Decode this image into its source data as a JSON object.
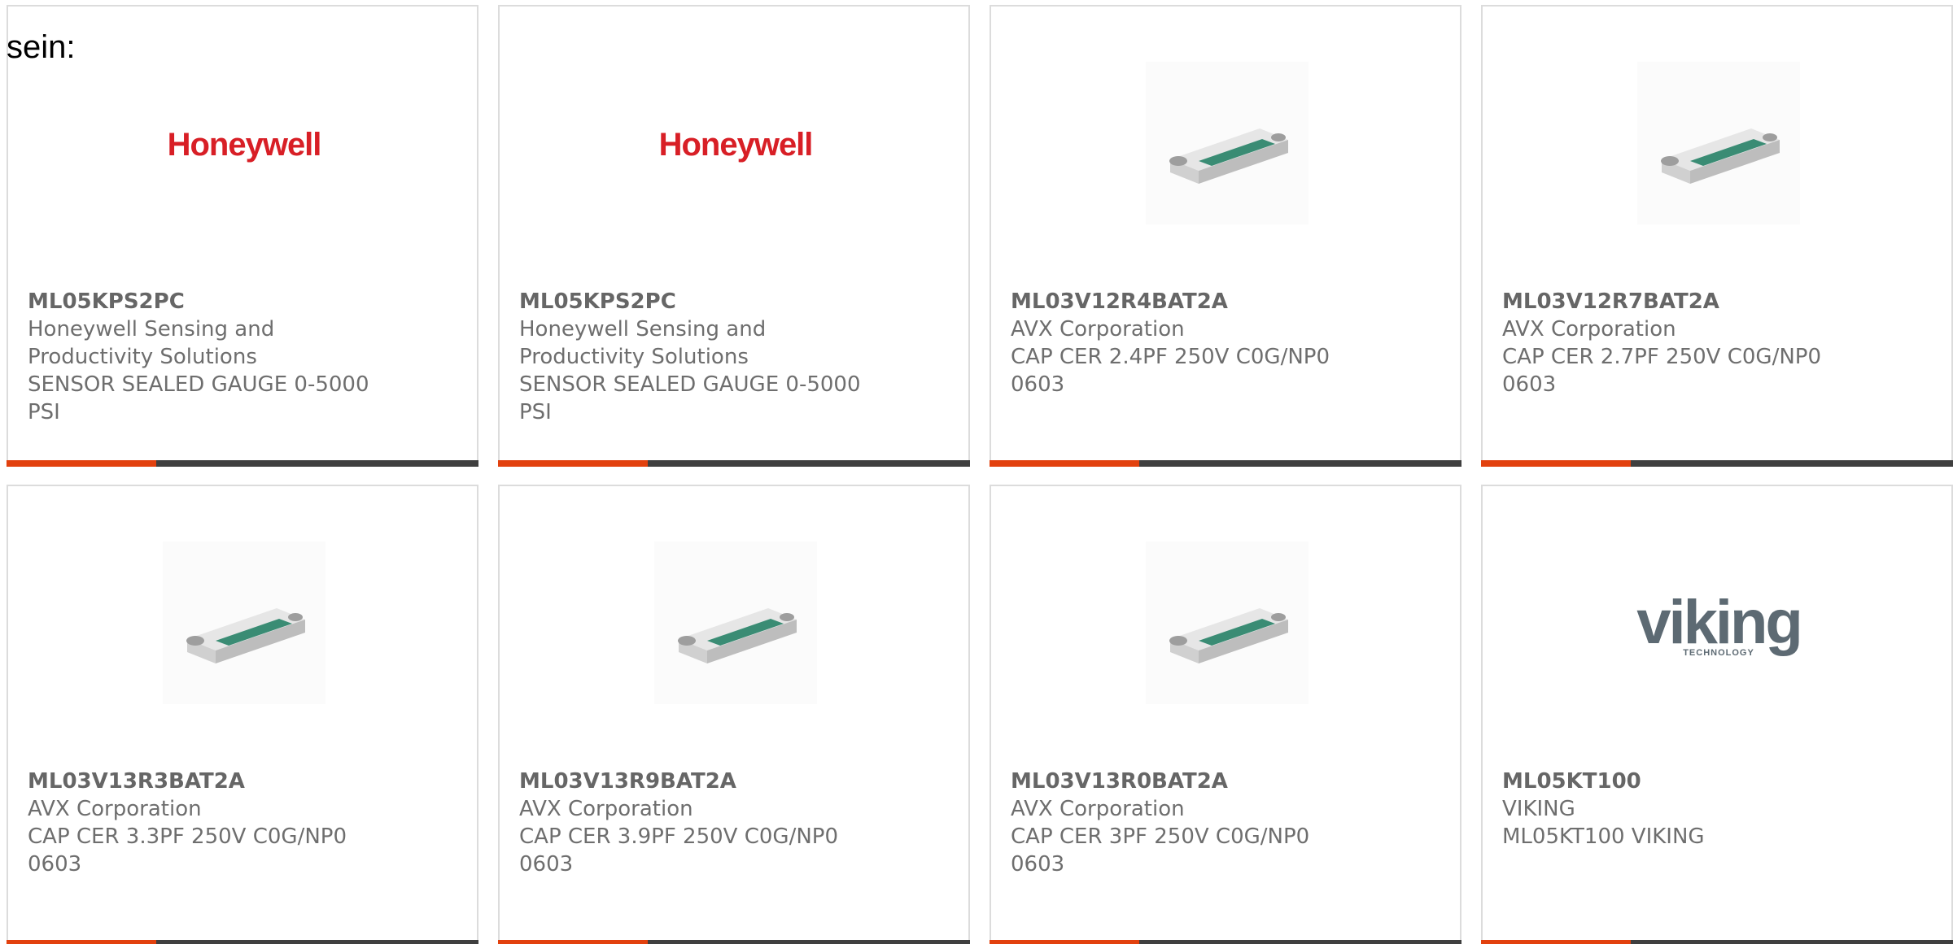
{
  "heading": "sein:",
  "cards": [
    {
      "part": "ML05KPS2PC",
      "manufacturer": "Honeywell Sensing and Productivity Solutions",
      "description": "SENSOR SEALED GAUGE 0-5000 PSI",
      "image": "honeywell-logo",
      "brand": "Honeywell"
    },
    {
      "part": "ML05KPS2PC",
      "manufacturer": "Honeywell Sensing and Productivity Solutions",
      "description": "SENSOR SEALED GAUGE 0-5000 PSI",
      "image": "honeywell-logo",
      "brand": "Honeywell"
    },
    {
      "part": "ML03V12R4BAT2A",
      "manufacturer": "AVX Corporation",
      "description": "CAP CER 2.4PF 250V C0G/NP0 0603",
      "image": "chip-capacitor"
    },
    {
      "part": "ML03V12R7BAT2A",
      "manufacturer": "AVX Corporation",
      "description": "CAP CER 2.7PF 250V C0G/NP0 0603",
      "image": "chip-capacitor"
    },
    {
      "part": "ML03V13R3BAT2A",
      "manufacturer": "AVX Corporation",
      "description": "CAP CER 3.3PF 250V C0G/NP0 0603",
      "image": "chip-capacitor"
    },
    {
      "part": "ML03V13R9BAT2A",
      "manufacturer": "AVX Corporation",
      "description": "CAP CER 3.9PF 250V C0G/NP0 0603",
      "image": "chip-capacitor"
    },
    {
      "part": "ML03V13R0BAT2A",
      "manufacturer": "AVX Corporation",
      "description": "CAP CER 3PF 250V C0G/NP0 0603",
      "image": "chip-capacitor"
    },
    {
      "part": "ML05KT100",
      "manufacturer": "VIKING",
      "description": "ML05KT100 VIKING",
      "image": "viking-logo",
      "brand": "viking",
      "brand_sub": "TECHNOLOGY"
    }
  ],
  "colors": {
    "accent": "#e2410e",
    "bar": "#3f3f3f",
    "capacitor_body": "#3a8c74",
    "honeywell_red": "#d81f26",
    "viking_gray": "#5d6a73"
  }
}
